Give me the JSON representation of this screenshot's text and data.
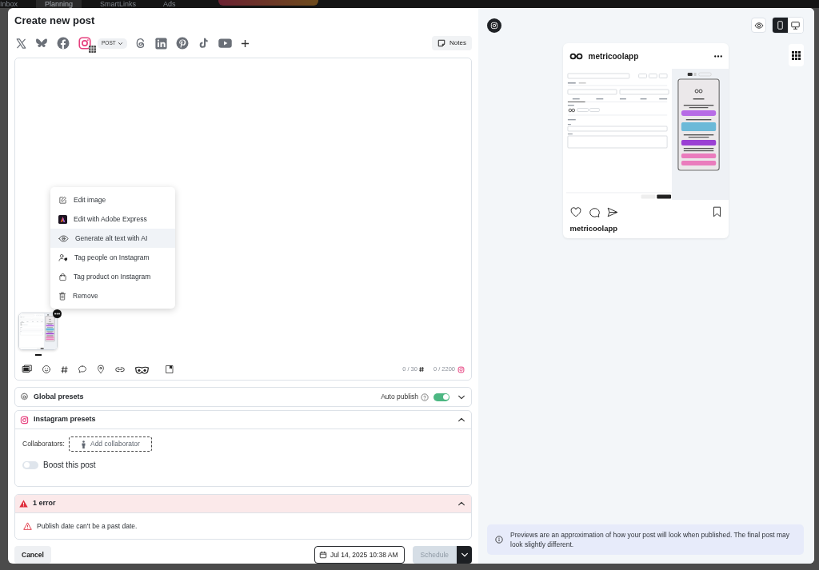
{
  "app_nav": {
    "items": [
      {
        "label": "Inbox",
        "selected": false
      },
      {
        "label": "Planning",
        "selected": true
      },
      {
        "label": "SmartLinks",
        "selected": false
      },
      {
        "label": "Ads",
        "selected": false
      }
    ]
  },
  "dialog": {
    "title": "Create new post"
  },
  "networks": [
    {
      "kind": "x",
      "selected": false
    },
    {
      "kind": "bluesky",
      "selected": false
    },
    {
      "kind": "facebook",
      "selected": false
    },
    {
      "kind": "instagram",
      "selected": true,
      "format": "POST"
    },
    {
      "kind": "threads",
      "selected": false
    },
    {
      "kind": "linkedin",
      "selected": false
    },
    {
      "kind": "pinterest",
      "selected": false
    },
    {
      "kind": "tiktok",
      "selected": false
    },
    {
      "kind": "youtube",
      "selected": false
    }
  ],
  "notes_button": "Notes",
  "attachment_menu": {
    "items": [
      {
        "kind": "edit",
        "label": "Edit image",
        "selected": false
      },
      {
        "kind": "adobe",
        "label": "Edit with Adobe Express",
        "selected": false
      },
      {
        "kind": "alt_text",
        "label": "Generate alt text with AI",
        "selected": true
      },
      {
        "kind": "tag_people",
        "label": "Tag people on Instagram",
        "selected": false
      },
      {
        "kind": "tag_product",
        "label": "Tag product on Instagram",
        "selected": false
      },
      {
        "kind": "remove",
        "label": "Remove",
        "selected": false
      }
    ]
  },
  "editor": {
    "hashtag_counter": "0 / 30",
    "character_counter": "0 / 2200"
  },
  "global_presets": {
    "title": "Global presets",
    "expanded": false,
    "auto_publish": {
      "label": "Auto publish",
      "on": true
    }
  },
  "instagram_presets": {
    "title": "Instagram presets",
    "expanded": true,
    "collaborators_label": "Collaborators:",
    "add_collaborator": "Add collaborator",
    "boost": {
      "label": "Boost this post",
      "on": false
    }
  },
  "errors": {
    "title": "1 error",
    "expanded": true,
    "items": [
      "Publish date can't be a past date."
    ]
  },
  "footer": {
    "cancel": "Cancel",
    "date": "Jul 14, 2025 10:38 AM",
    "schedule": {
      "label": "Schedule",
      "disabled": true
    }
  },
  "preview": {
    "view_modes": [
      {
        "kind": "mobile",
        "selected": true
      },
      {
        "kind": "desktop",
        "selected": false
      }
    ],
    "post": {
      "account": "metricoolapp",
      "caption_account": "metricoolapp"
    },
    "notice": "Previews are an approximation of how your post will look when published. The final post may look slightly different."
  }
}
